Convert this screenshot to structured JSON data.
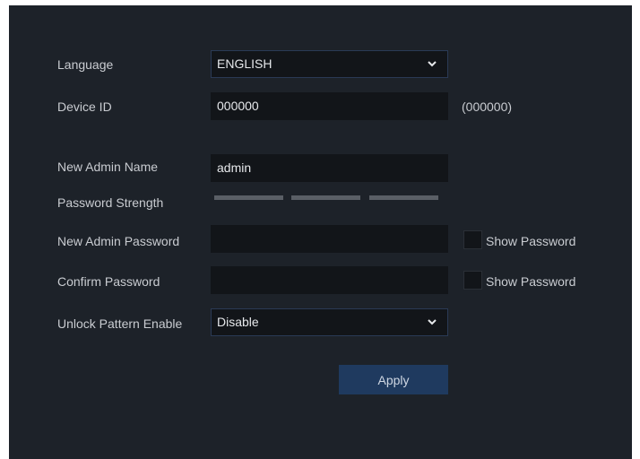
{
  "form": {
    "language_label": "Language",
    "language_value": "ENGLISH",
    "device_id_label": "Device ID",
    "device_id_value": "000000",
    "device_id_hint": "(000000)",
    "admin_name_label": "New Admin Name",
    "admin_name_value": "admin",
    "strength_label": "Password Strength",
    "admin_password_label": "New Admin Password",
    "admin_password_value": "",
    "confirm_password_label": "Confirm Password",
    "confirm_password_value": "",
    "show_password_label_1": "Show Password",
    "show_password_label_2": "Show Password",
    "unlock_label": "Unlock Pattern Enable",
    "unlock_value": "Disable",
    "apply_label": "Apply"
  },
  "colors": {
    "panel_bg": "#1d2229",
    "field_bg": "#121519",
    "button_bg": "#1f3a5f",
    "strength_bar": "#5a5f66"
  },
  "icons": {
    "dropdown": "chevron-down-icon"
  }
}
